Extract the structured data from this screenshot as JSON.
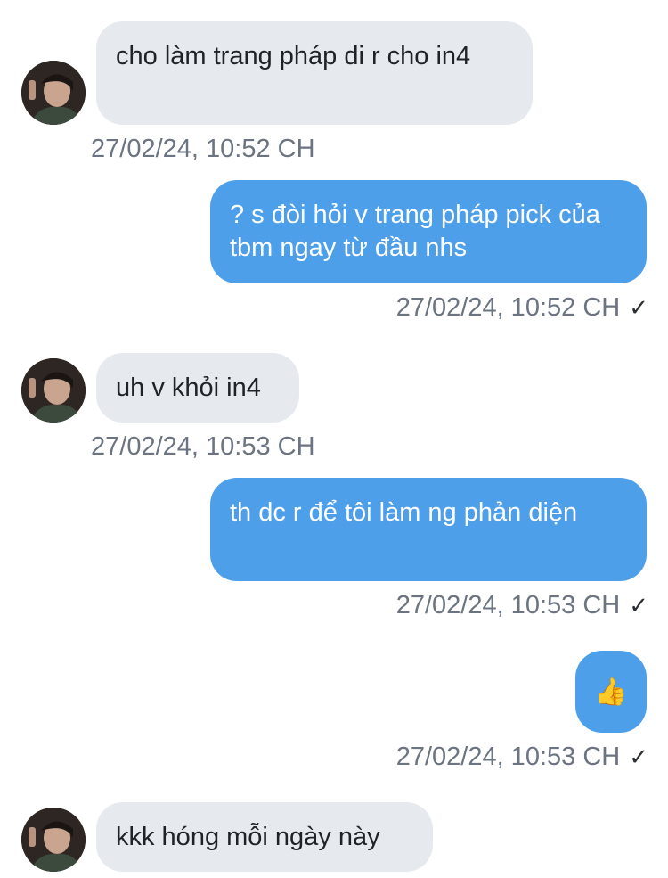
{
  "messages": [
    {
      "direction": "incoming",
      "text": "cho làm trang pháp di r cho in4",
      "time": "27/02/24, 10:52 CH"
    },
    {
      "direction": "outgoing",
      "text": "? s đòi hỏi v trang pháp pick của tbm ngay từ đầu nhs",
      "time": "27/02/24, 10:52 CH",
      "status": "✓"
    },
    {
      "direction": "incoming",
      "text": "uh v khỏi in4",
      "time": "27/02/24, 10:53 CH"
    },
    {
      "direction": "outgoing",
      "text": "th dc r để tôi làm ng phản diện",
      "time": "27/02/24, 10:53 CH",
      "status": "✓"
    },
    {
      "direction": "outgoing",
      "text": "👍",
      "time": "27/02/24, 10:53 CH",
      "status": "✓"
    },
    {
      "direction": "incoming",
      "text": "kkk hóng mỗi ngày này"
    }
  ],
  "colors": {
    "incoming_bubble": "#e6e9ee",
    "outgoing_bubble": "#4d9fea",
    "timestamp": "#6b7480"
  }
}
